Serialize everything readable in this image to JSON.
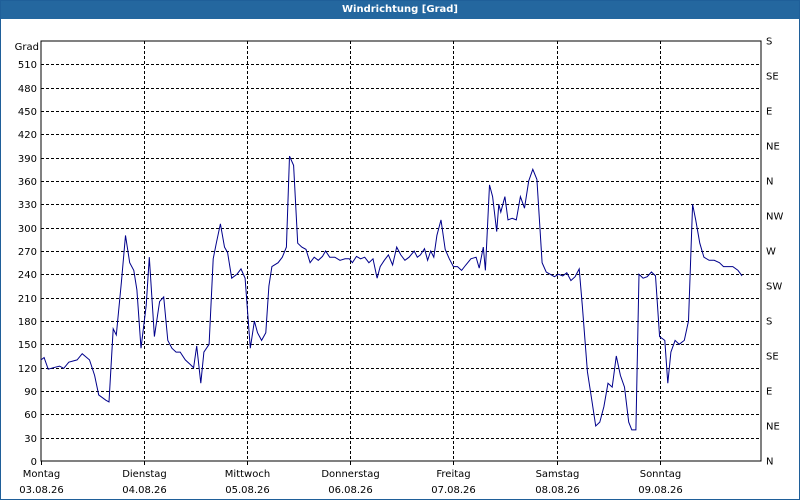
{
  "window": {
    "title": "Windrichtung [Grad]"
  },
  "colors": {
    "title_bar": "#24679f",
    "series_line": "#00008b",
    "grid": "#000000"
  },
  "chart_data": {
    "type": "line",
    "title": "Windrichtung [Grad]",
    "ylabel": "Grad",
    "ylim": [
      0,
      540
    ],
    "yticks": [
      0,
      30,
      60,
      90,
      120,
      150,
      180,
      210,
      240,
      270,
      300,
      330,
      360,
      390,
      420,
      450,
      480,
      510
    ],
    "y2ticks": [
      {
        "value": 0,
        "label": "N"
      },
      {
        "value": 45,
        "label": "NE"
      },
      {
        "value": 90,
        "label": "E"
      },
      {
        "value": 135,
        "label": "SE"
      },
      {
        "value": 180,
        "label": "S"
      },
      {
        "value": 225,
        "label": "SW"
      },
      {
        "value": 270,
        "label": "W"
      },
      {
        "value": 315,
        "label": "NW"
      },
      {
        "value": 360,
        "label": "N"
      },
      {
        "value": 405,
        "label": "NE"
      },
      {
        "value": 450,
        "label": "E"
      },
      {
        "value": 495,
        "label": "SE"
      },
      {
        "value": 540,
        "label": "S"
      }
    ],
    "xlim": [
      0,
      7
    ],
    "xticks": [
      {
        "x": 0,
        "day": "Montag",
        "date": "03.08.26"
      },
      {
        "x": 1,
        "day": "Dienstag",
        "date": "04.08.26"
      },
      {
        "x": 2,
        "day": "Mittwoch",
        "date": "05.08.26"
      },
      {
        "x": 3,
        "day": "Donnerstag",
        "date": "06.08.26"
      },
      {
        "x": 4,
        "day": "Freitag",
        "date": "07.08.26"
      },
      {
        "x": 5,
        "day": "Samstag",
        "date": "08.08.26"
      },
      {
        "x": 6,
        "day": "Sonntag",
        "date": "09.08.26"
      }
    ],
    "grid": true,
    "series": [
      {
        "points": [
          [
            0.0,
            130
          ],
          [
            0.03,
            133
          ],
          [
            0.07,
            118
          ],
          [
            0.12,
            120
          ],
          [
            0.18,
            122
          ],
          [
            0.22,
            119
          ],
          [
            0.27,
            127
          ],
          [
            0.35,
            130
          ],
          [
            0.4,
            138
          ],
          [
            0.47,
            130
          ],
          [
            0.52,
            110
          ],
          [
            0.56,
            85
          ],
          [
            0.63,
            78
          ],
          [
            0.66,
            76
          ],
          [
            0.7,
            170
          ],
          [
            0.73,
            162
          ],
          [
            0.78,
            230
          ],
          [
            0.82,
            290
          ],
          [
            0.86,
            255
          ],
          [
            0.9,
            245
          ],
          [
            0.93,
            220
          ],
          [
            0.97,
            145
          ],
          [
            1.02,
            200
          ],
          [
            1.05,
            262
          ],
          [
            1.1,
            160
          ],
          [
            1.15,
            205
          ],
          [
            1.19,
            211
          ],
          [
            1.23,
            155
          ],
          [
            1.27,
            145
          ],
          [
            1.31,
            140
          ],
          [
            1.35,
            140
          ],
          [
            1.4,
            130
          ],
          [
            1.44,
            125
          ],
          [
            1.48,
            120
          ],
          [
            1.51,
            148
          ],
          [
            1.55,
            100
          ],
          [
            1.58,
            140
          ],
          [
            1.63,
            150
          ],
          [
            1.67,
            260
          ],
          [
            1.7,
            280
          ],
          [
            1.74,
            305
          ],
          [
            1.78,
            275
          ],
          [
            1.81,
            268
          ],
          [
            1.85,
            235
          ],
          [
            1.9,
            240
          ],
          [
            1.94,
            247
          ],
          [
            1.98,
            235
          ],
          [
            2.03,
            145
          ],
          [
            2.07,
            180
          ],
          [
            2.1,
            165
          ],
          [
            2.14,
            155
          ],
          [
            2.18,
            165
          ],
          [
            2.21,
            225
          ],
          [
            2.24,
            250
          ],
          [
            2.3,
            255
          ],
          [
            2.34,
            262
          ],
          [
            2.38,
            275
          ],
          [
            2.41,
            392
          ],
          [
            2.45,
            380
          ],
          [
            2.49,
            280
          ],
          [
            2.53,
            275
          ],
          [
            2.57,
            272
          ],
          [
            2.61,
            255
          ],
          [
            2.65,
            262
          ],
          [
            2.69,
            258
          ],
          [
            2.73,
            263
          ],
          [
            2.76,
            270
          ],
          [
            2.8,
            262
          ],
          [
            2.85,
            262
          ],
          [
            2.9,
            258
          ],
          [
            2.95,
            260
          ],
          [
            2.99,
            260
          ],
          [
            3.02,
            255
          ],
          [
            3.06,
            263
          ],
          [
            3.1,
            260
          ],
          [
            3.14,
            262
          ],
          [
            3.18,
            255
          ],
          [
            3.22,
            260
          ],
          [
            3.26,
            235
          ],
          [
            3.29,
            250
          ],
          [
            3.33,
            258
          ],
          [
            3.37,
            265
          ],
          [
            3.41,
            252
          ],
          [
            3.45,
            275
          ],
          [
            3.49,
            265
          ],
          [
            3.53,
            258
          ],
          [
            3.57,
            262
          ],
          [
            3.62,
            270
          ],
          [
            3.65,
            262
          ],
          [
            3.68,
            265
          ],
          [
            3.72,
            273
          ],
          [
            3.75,
            258
          ],
          [
            3.78,
            270
          ],
          [
            3.81,
            262
          ],
          [
            3.84,
            290
          ],
          [
            3.88,
            310
          ],
          [
            3.92,
            272
          ],
          [
            3.96,
            260
          ],
          [
            4.0,
            250
          ],
          [
            4.04,
            250
          ],
          [
            4.08,
            245
          ],
          [
            4.12,
            252
          ],
          [
            4.17,
            260
          ],
          [
            4.22,
            262
          ],
          [
            4.25,
            248
          ],
          [
            4.29,
            275
          ],
          [
            4.31,
            245
          ],
          [
            4.35,
            355
          ],
          [
            4.38,
            340
          ],
          [
            4.42,
            295
          ],
          [
            4.44,
            330
          ],
          [
            4.46,
            320
          ],
          [
            4.5,
            340
          ],
          [
            4.53,
            310
          ],
          [
            4.57,
            312
          ],
          [
            4.61,
            310
          ],
          [
            4.65,
            340
          ],
          [
            4.69,
            325
          ],
          [
            4.73,
            360
          ],
          [
            4.77,
            375
          ],
          [
            4.81,
            362
          ],
          [
            4.86,
            255
          ],
          [
            4.9,
            243
          ],
          [
            4.94,
            240
          ],
          [
            4.98,
            237
          ],
          [
            5.02,
            240
          ],
          [
            5.06,
            238
          ],
          [
            5.1,
            242
          ],
          [
            5.14,
            232
          ],
          [
            5.18,
            237
          ],
          [
            5.22,
            247
          ],
          [
            5.25,
            200
          ],
          [
            5.3,
            115
          ],
          [
            5.34,
            80
          ],
          [
            5.38,
            45
          ],
          [
            5.42,
            50
          ],
          [
            5.46,
            70
          ],
          [
            5.5,
            100
          ],
          [
            5.54,
            95
          ],
          [
            5.58,
            135
          ],
          [
            5.62,
            110
          ],
          [
            5.66,
            95
          ],
          [
            5.7,
            50
          ],
          [
            5.73,
            40
          ],
          [
            5.77,
            40
          ],
          [
            5.8,
            240
          ],
          [
            5.84,
            235
          ],
          [
            5.88,
            237
          ],
          [
            5.92,
            243
          ],
          [
            5.96,
            238
          ],
          [
            6.0,
            160
          ],
          [
            6.05,
            155
          ],
          [
            6.08,
            100
          ],
          [
            6.11,
            140
          ],
          [
            6.15,
            155
          ],
          [
            6.19,
            150
          ],
          [
            6.24,
            155
          ],
          [
            6.28,
            180
          ],
          [
            6.32,
            330
          ],
          [
            6.35,
            310
          ],
          [
            6.39,
            280
          ],
          [
            6.43,
            262
          ],
          [
            6.48,
            258
          ],
          [
            6.53,
            258
          ],
          [
            6.58,
            255
          ],
          [
            6.62,
            250
          ],
          [
            6.67,
            250
          ],
          [
            6.71,
            250
          ],
          [
            6.76,
            245
          ],
          [
            6.8,
            238
          ]
        ]
      }
    ]
  }
}
